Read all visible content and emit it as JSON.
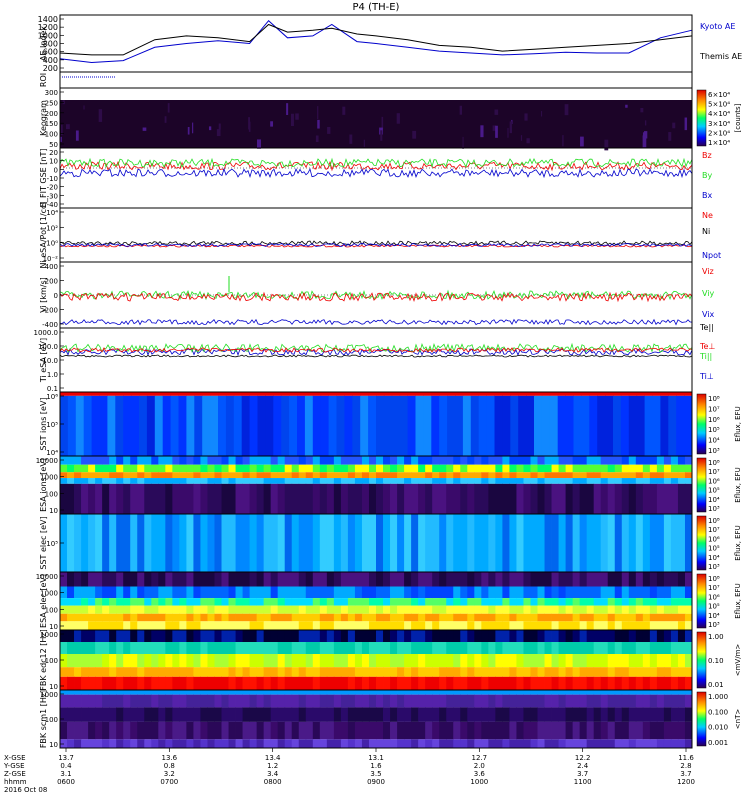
{
  "title": "P4 (TH-E)",
  "colors": {
    "black": "#000000",
    "red": "#ee0000",
    "green": "#22dd22",
    "blue": "#0000cc",
    "navy": "#00006e",
    "purple": "#3a0a6a",
    "orange": "#ff7700"
  },
  "chart_data": [
    {
      "panel": "ae",
      "type": "line",
      "ylabel": "AE Index",
      "yticks": [
        "1400",
        "1200",
        "1000",
        "800",
        "600",
        "400",
        "200"
      ],
      "ylim": [
        0,
        1500
      ],
      "series": [
        {
          "name": "Kyoto AE",
          "color": "#0000cc",
          "x": [
            0,
            0.05,
            0.1,
            0.15,
            0.2,
            0.25,
            0.3,
            0.33,
            0.36,
            0.4,
            0.43,
            0.47,
            0.5,
            0.55,
            0.6,
            0.65,
            0.7,
            0.75,
            0.8,
            0.85,
            0.9,
            0.95,
            1.0
          ],
          "y": [
            350,
            250,
            300,
            650,
            750,
            820,
            750,
            1350,
            900,
            950,
            1250,
            800,
            750,
            650,
            550,
            500,
            450,
            480,
            520,
            500,
            500,
            900,
            1100
          ]
        },
        {
          "name": "Themis AE",
          "color": "#000000",
          "x": [
            0,
            0.05,
            0.1,
            0.15,
            0.2,
            0.25,
            0.3,
            0.33,
            0.36,
            0.4,
            0.43,
            0.47,
            0.5,
            0.55,
            0.6,
            0.65,
            0.7,
            0.75,
            0.8,
            0.85,
            0.9,
            0.95,
            1.0
          ],
          "y": [
            500,
            450,
            450,
            850,
            950,
            900,
            800,
            1250,
            1050,
            1100,
            1150,
            1000,
            950,
            850,
            700,
            650,
            550,
            600,
            650,
            700,
            750,
            850,
            950
          ]
        }
      ]
    },
    {
      "panel": "roi",
      "type": "line",
      "ylabel": "ROI"
    },
    {
      "panel": "keogram",
      "type": "heatmap",
      "ylabel": "Keogram",
      "yticks": [
        "300",
        "250",
        "200",
        "150",
        "100",
        "50"
      ],
      "colorbar_label": "[counts]",
      "colorbar_ticks": [
        "6×10⁴",
        "5×10⁴",
        "4×10⁴",
        "3×10⁴",
        "2×10⁴",
        "1×10⁴"
      ]
    },
    {
      "panel": "bfield",
      "type": "line",
      "ylabel": "B_FIT GSE [nT]",
      "yticks": [
        "20",
        "10",
        "0",
        "-10",
        "-20",
        "-30",
        "-40"
      ],
      "ylim": [
        -40,
        20
      ],
      "series": [
        {
          "name": "Bz",
          "color": "#ee0000",
          "level": 2
        },
        {
          "name": "By",
          "color": "#22dd22",
          "level": 5
        },
        {
          "name": "Bx",
          "color": "#0000cc",
          "level": -5
        }
      ]
    },
    {
      "panel": "density",
      "type": "line",
      "ylabel": "Ni eSA/Pot [1/cc]",
      "yticks": [
        "10⁴",
        "10²",
        "10⁰",
        "10⁻²"
      ],
      "series": [
        {
          "name": "Ne",
          "color": "#ee0000"
        },
        {
          "name": "Ni",
          "color": "#000000"
        },
        {
          "name": "Npot",
          "color": "#0000cc"
        }
      ]
    },
    {
      "panel": "velocity",
      "type": "line",
      "ylabel": "Vi [km/s]",
      "yticks": [
        "400",
        "200",
        "0",
        "-200",
        "-400"
      ],
      "ylim": [
        -450,
        450
      ],
      "series": [
        {
          "name": "Viz",
          "color": "#ee0000",
          "level": 0
        },
        {
          "name": "Viy",
          "color": "#22dd22",
          "level": 0
        },
        {
          "name": "Vix",
          "color": "#0000cc",
          "level": -370
        }
      ]
    },
    {
      "panel": "temperature",
      "type": "line",
      "ylabel": "Ti eSA [eV]",
      "yticks": [
        "1000.0",
        "100.0",
        "10.0",
        "1.0",
        "0.1"
      ],
      "series": [
        {
          "name": "Te||",
          "color": "#000000"
        },
        {
          "name": "Te⊥",
          "color": "#ee0000"
        },
        {
          "name": "Ti||",
          "color": "#22dd22"
        },
        {
          "name": "Ti⊥",
          "color": "#0000cc"
        }
      ]
    },
    {
      "panel": "sst_i",
      "type": "heatmap",
      "ylabel": "SST ions [eV]",
      "yticks": [
        "10⁶",
        "10⁵",
        "10⁴"
      ],
      "colorbar_label": "Eflux, EFU",
      "colorbar_ticks": [
        "10⁸",
        "10⁷",
        "10⁶",
        "10⁵",
        "10⁴",
        "10³"
      ]
    },
    {
      "panel": "esa_i",
      "type": "heatmap",
      "ylabel": "ESA ions [eV]",
      "yticks": [
        "10000",
        "1000",
        "100",
        "10"
      ],
      "colorbar_label": "Eflux, EFU",
      "colorbar_ticks": [
        "10⁸",
        "10⁷",
        "10⁶",
        "10⁵",
        "10⁴",
        "10³"
      ]
    },
    {
      "panel": "sst_e",
      "type": "heatmap",
      "ylabel": "SST elec [eV]",
      "yticks": [
        "10⁵"
      ],
      "colorbar_label": "Eflux, EFU",
      "colorbar_ticks": [
        "10⁸",
        "10⁷",
        "10⁶",
        "10⁵",
        "10⁴",
        "10³"
      ]
    },
    {
      "panel": "esa_e",
      "type": "heatmap",
      "ylabel": "ESA elec [eV]",
      "yticks": [
        "10000",
        "1000",
        "100",
        "10"
      ],
      "colorbar_label": "Eflux, EFU",
      "colorbar_ticks": [
        "10⁸",
        "10⁷",
        "10⁶",
        "10⁵",
        "10⁴",
        "10³"
      ]
    },
    {
      "panel": "fbk_e",
      "type": "heatmap",
      "ylabel": "FBK edc12 [Hz]",
      "yticks": [
        "1000",
        "100",
        "10"
      ],
      "colorbar_label": "<mV/m>",
      "colorbar_ticks": [
        "1.00",
        "0.10",
        "0.01"
      ]
    },
    {
      "panel": "fbk_b",
      "type": "heatmap",
      "ylabel": "FBK scm1 [Hz]",
      "yticks": [
        "1000",
        "100",
        "10"
      ],
      "colorbar_label": "<nT>",
      "colorbar_ticks": [
        "1.000",
        "0.100",
        "0.010",
        "0.001"
      ]
    }
  ],
  "xaxis": {
    "row_labels": [
      "X-GSE",
      "Y-GSE",
      "Z-GSE",
      "hhmm",
      "2016 Oct 08"
    ],
    "rows": [
      [
        "13.7",
        "13.6",
        "13.4",
        "13.1",
        "12.7",
        "12.2",
        "11.6"
      ],
      [
        "0.4",
        "0.8",
        "1.2",
        "1.6",
        "2.0",
        "2.4",
        "2.8"
      ],
      [
        "3.1",
        "3.2",
        "3.4",
        "3.5",
        "3.6",
        "3.7",
        "3.7"
      ],
      [
        "0600",
        "0700",
        "0800",
        "0900",
        "1000",
        "1100",
        "1200"
      ]
    ]
  }
}
